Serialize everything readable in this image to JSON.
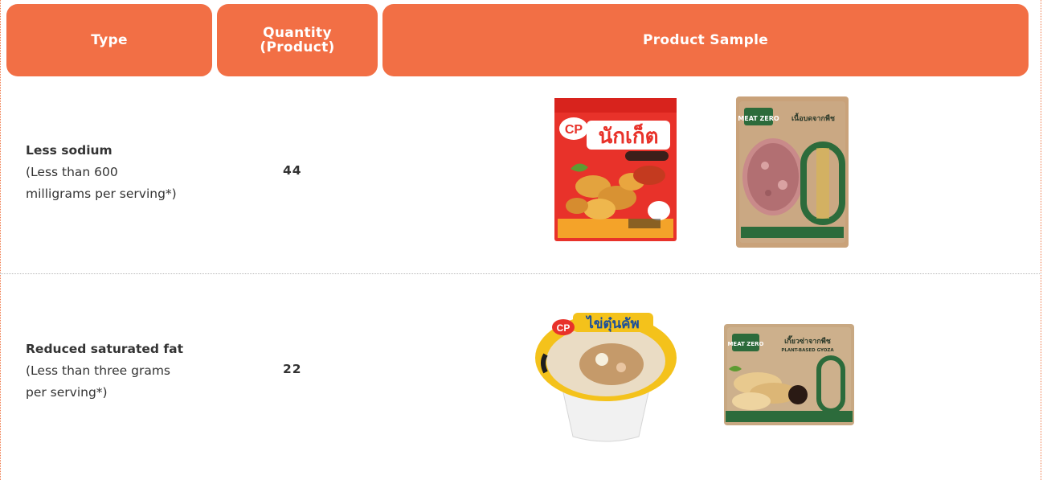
{
  "header": {
    "type_label": "Type",
    "quantity_label_line1": "Quantity",
    "quantity_label_line2": "(Product)",
    "sample_label": "Product Sample"
  },
  "rows": [
    {
      "type_title": "Less sodium",
      "type_desc_line1": "(Less than 600",
      "type_desc_line2": "milligrams per serving*)",
      "quantity": "44",
      "products": [
        {
          "name": "cp-nuggets-package",
          "brand_text": "CP",
          "thai_name": "นักเก็ต"
        },
        {
          "name": "meat-zero-plant-based-minced-package",
          "brand_text": "MEAT ZERO",
          "thai_name": "เนื้อบดจากพืช"
        }
      ]
    },
    {
      "type_title": "Reduced saturated fat",
      "type_desc_line1": "(Less than three grams",
      "type_desc_line2": "per serving*)",
      "quantity": "22",
      "products": [
        {
          "name": "cp-steamed-egg-cup",
          "brand_text": "CP",
          "thai_name": "ไข่ตุ๋นคัพ"
        },
        {
          "name": "meat-zero-plant-based-gyoza-package",
          "brand_text": "MEAT ZERO",
          "thai_name": "เกี๊ยวซ่าจากพืช",
          "subtitle": "PLANT-BASED GYOZA"
        }
      ]
    }
  ]
}
